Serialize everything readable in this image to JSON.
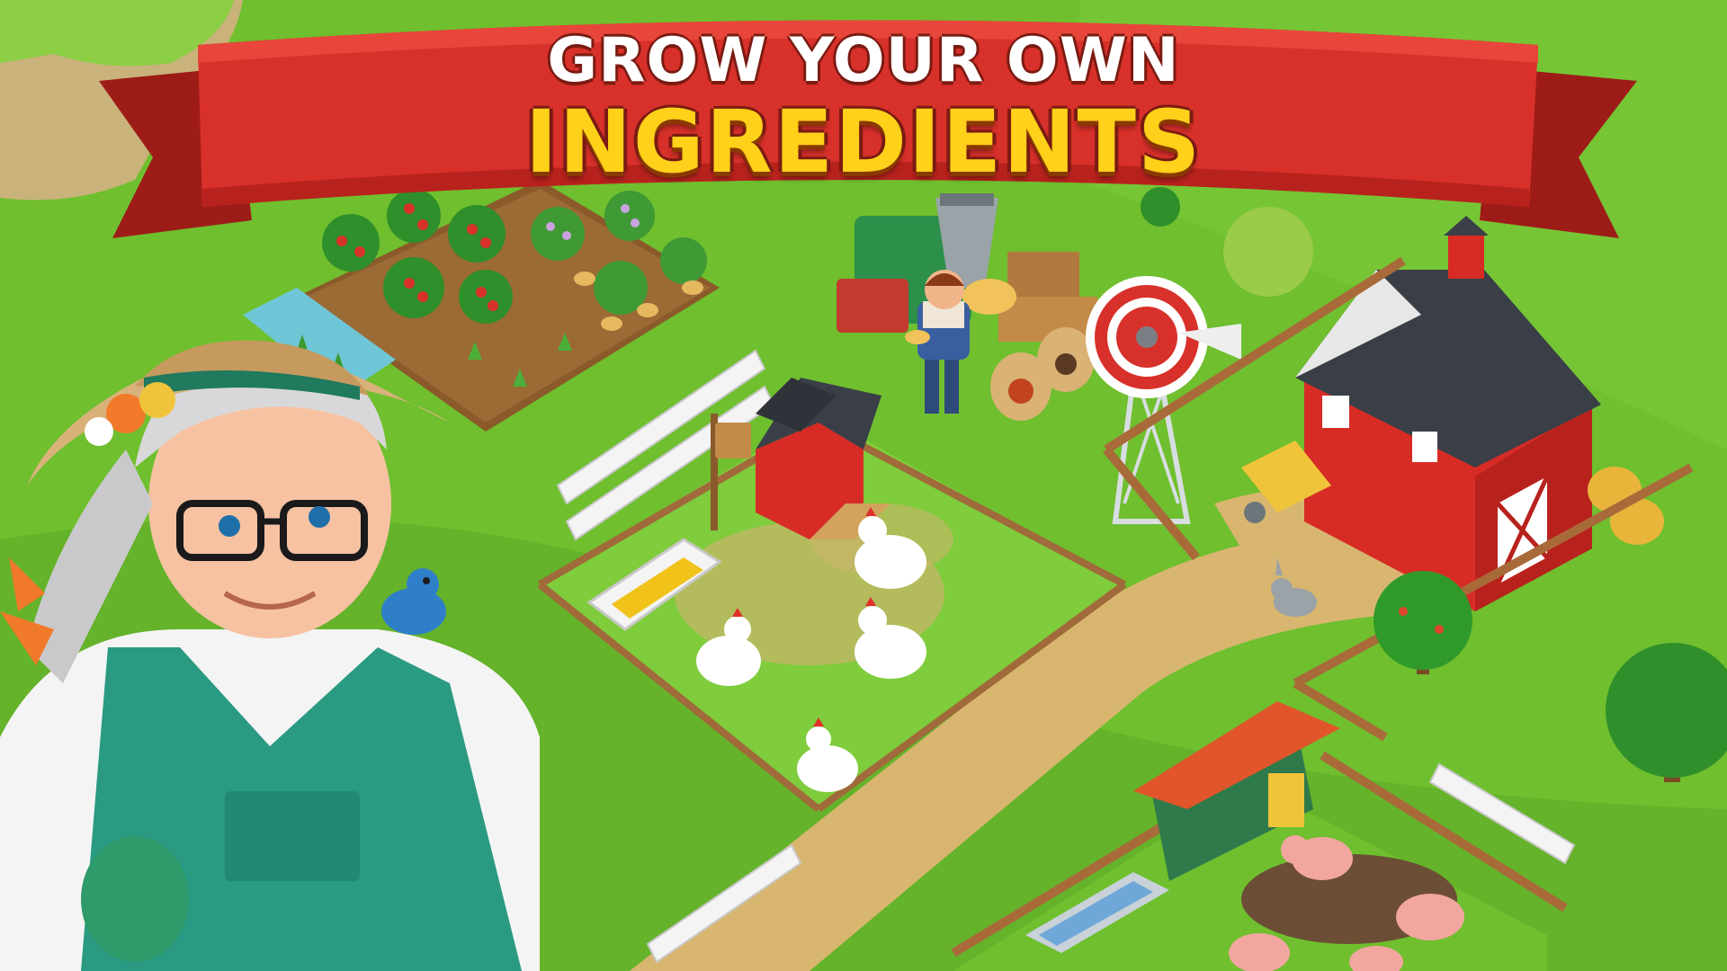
{
  "banner": {
    "line1": "GROW YOUR OWN",
    "line2": "INGREDIENTS"
  },
  "colors": {
    "grass": "#6fbf2e",
    "banner_red": "#d8302a",
    "banner_dark": "#9e1c18",
    "headline_yellow": "#ffd11a",
    "barn_red": "#d62c25",
    "path": "#d8b670"
  },
  "scene": {
    "characters": [
      "grandma-character",
      "farmer-character",
      "bluebird"
    ],
    "animals": [
      "chicken",
      "chicken",
      "chicken",
      "chicken",
      "chicken",
      "rabbit",
      "pig",
      "pig",
      "pig",
      "pig"
    ],
    "buildings": [
      "barn",
      "chicken-coop",
      "windmill",
      "mill-machine",
      "pig-shed"
    ],
    "crops": [
      "tomato-plants",
      "potato-plants",
      "sprouts"
    ]
  }
}
